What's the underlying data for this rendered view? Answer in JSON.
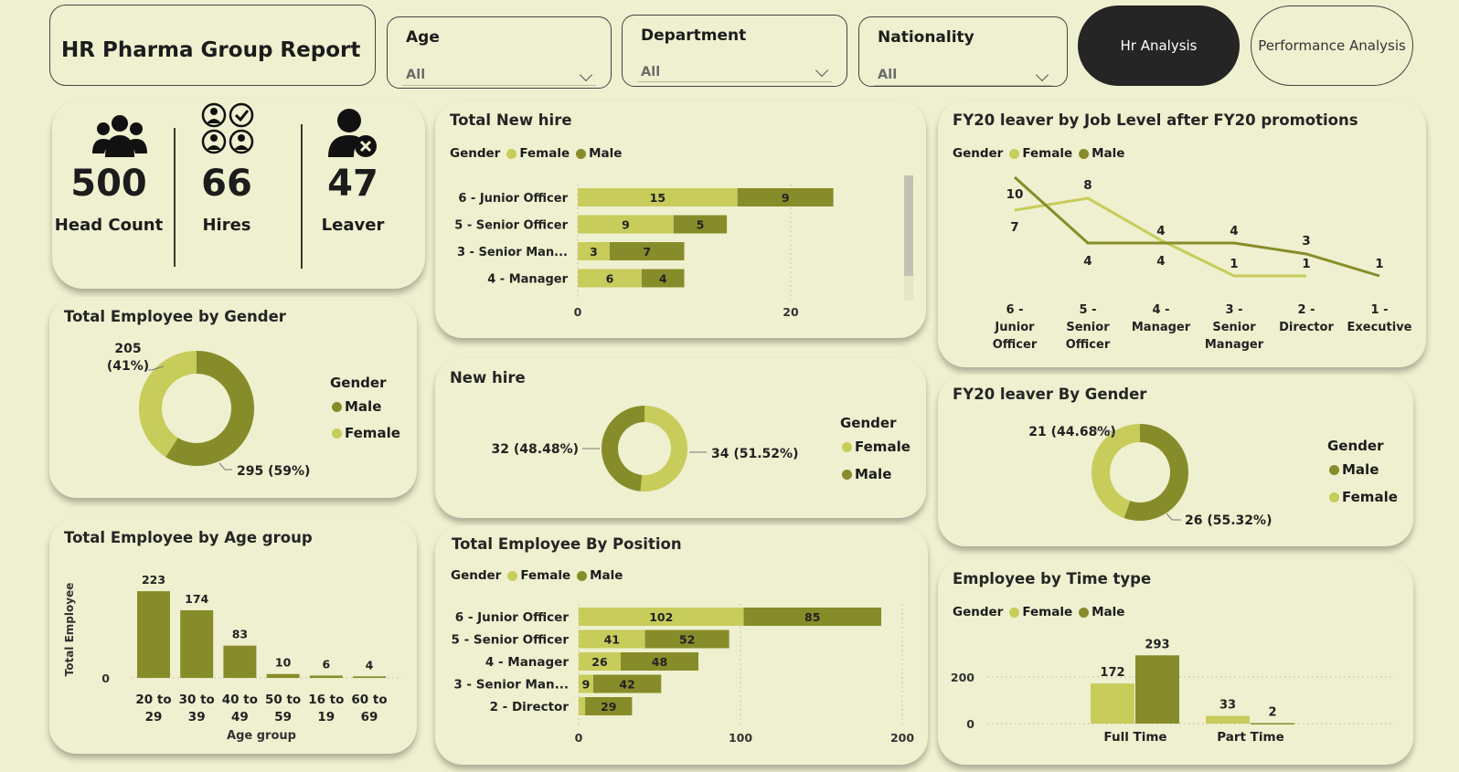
{
  "report": {
    "title": "HR Pharma Group Report"
  },
  "filters": [
    {
      "label": "Age",
      "value": "All"
    },
    {
      "label": "Department",
      "value": "All"
    },
    {
      "label": "Nationality",
      "value": "All"
    }
  ],
  "nav": {
    "active": "Hr Analysis",
    "other": "Performance Analysis"
  },
  "kpis": [
    {
      "value": "500",
      "label": "Head Count",
      "icon": "group-icon"
    },
    {
      "value": "66",
      "label": "Hires",
      "icon": "people-check-icon"
    },
    {
      "value": "47",
      "label": "Leaver",
      "icon": "person-remove-icon"
    }
  ],
  "colors": {
    "female": "#c7cc5a",
    "male": "#878c2a",
    "background": "#eef0cf",
    "active_button": "#252525"
  },
  "legend": {
    "title": "Gender",
    "female": "Female",
    "male": "Male"
  },
  "gender_chart": {
    "title": "Total Employee by Gender",
    "label_female": "205\n(41%)",
    "label_male": "295 (59%)",
    "chart_data": {
      "type": "pie",
      "donut": true,
      "categories": [
        "Male",
        "Female"
      ],
      "values": [
        295,
        205
      ]
    }
  },
  "age_chart": {
    "title": "Total Employee by Age group",
    "xlabel": "Age group",
    "ylabel": "Total Employee",
    "yticks": [
      "0",
      "100",
      "200"
    ],
    "chart_data": {
      "type": "bar",
      "categories": [
        "20 to 29",
        "30 to 39",
        "40 to 49",
        "50 to 59",
        "16 to 19",
        "60 to 69"
      ],
      "values": [
        223,
        174,
        83,
        10,
        6,
        4
      ],
      "ylim": [
        0,
        240
      ]
    }
  },
  "newhire_bar": {
    "title": "Total New hire",
    "xticks": [
      "0",
      "20"
    ],
    "chart_data": {
      "type": "bar",
      "orientation": "horizontal",
      "stacked": true,
      "categories": [
        "6 - Junior Officer",
        "5 - Senior Officer",
        "3 - Senior Man...",
        "4 - Manager"
      ],
      "series": [
        {
          "name": "Female",
          "values": [
            15,
            9,
            3,
            6
          ]
        },
        {
          "name": "Male",
          "values": [
            9,
            5,
            7,
            4
          ]
        }
      ],
      "xlim": [
        0,
        26
      ]
    }
  },
  "newhire_donut": {
    "title": "New hire",
    "label_male": "32 (48.48%)",
    "label_female": "34 (51.52%)",
    "chart_data": {
      "type": "pie",
      "donut": true,
      "categories": [
        "Female",
        "Male"
      ],
      "values": [
        34,
        32
      ]
    }
  },
  "position_bar": {
    "title": "Total Employee By Position",
    "xticks": [
      "0",
      "100",
      "200"
    ],
    "chart_data": {
      "type": "bar",
      "orientation": "horizontal",
      "stacked": true,
      "categories": [
        "6 - Junior Officer",
        "5 - Senior Officer",
        "4 - Manager",
        "3 - Senior Man...",
        "2 - Director"
      ],
      "series": [
        {
          "name": "Female",
          "values": [
            102,
            41,
            26,
            9,
            4
          ]
        },
        {
          "name": "Male",
          "values": [
            85,
            52,
            48,
            42,
            29
          ]
        }
      ],
      "xlim": [
        0,
        200
      ]
    }
  },
  "leaver_line": {
    "title": "FY20 leaver by Job Level after FY20 promotions",
    "chart_data": {
      "type": "line",
      "categories": [
        "6 - Junior Officer",
        "5 - Senior Officer",
        "4 - Manager",
        "3 - Senior Manager",
        "2 - Director",
        "1 - Executive"
      ],
      "series": [
        {
          "name": "Female",
          "values": [
            7,
            8,
            4,
            1,
            1,
            null
          ]
        },
        {
          "name": "Male",
          "values": [
            10,
            4,
            4,
            4,
            3,
            1
          ]
        }
      ]
    }
  },
  "leaver_gender": {
    "title": "FY20 leaver By Gender",
    "label_female": "21 (44.68%)",
    "label_male": "26 (55.32%)",
    "chart_data": {
      "type": "pie",
      "donut": true,
      "categories": [
        "Male",
        "Female"
      ],
      "values": [
        26,
        21
      ]
    }
  },
  "timetype": {
    "title": "Employee by Time type",
    "yticks": [
      "0",
      "200"
    ],
    "chart_data": {
      "type": "bar",
      "categories": [
        "Full Time",
        "Part Time"
      ],
      "series": [
        {
          "name": "Female",
          "values": [
            172,
            33
          ]
        },
        {
          "name": "Male",
          "values": [
            293,
            2
          ]
        }
      ],
      "ylim": [
        0,
        300
      ]
    }
  }
}
